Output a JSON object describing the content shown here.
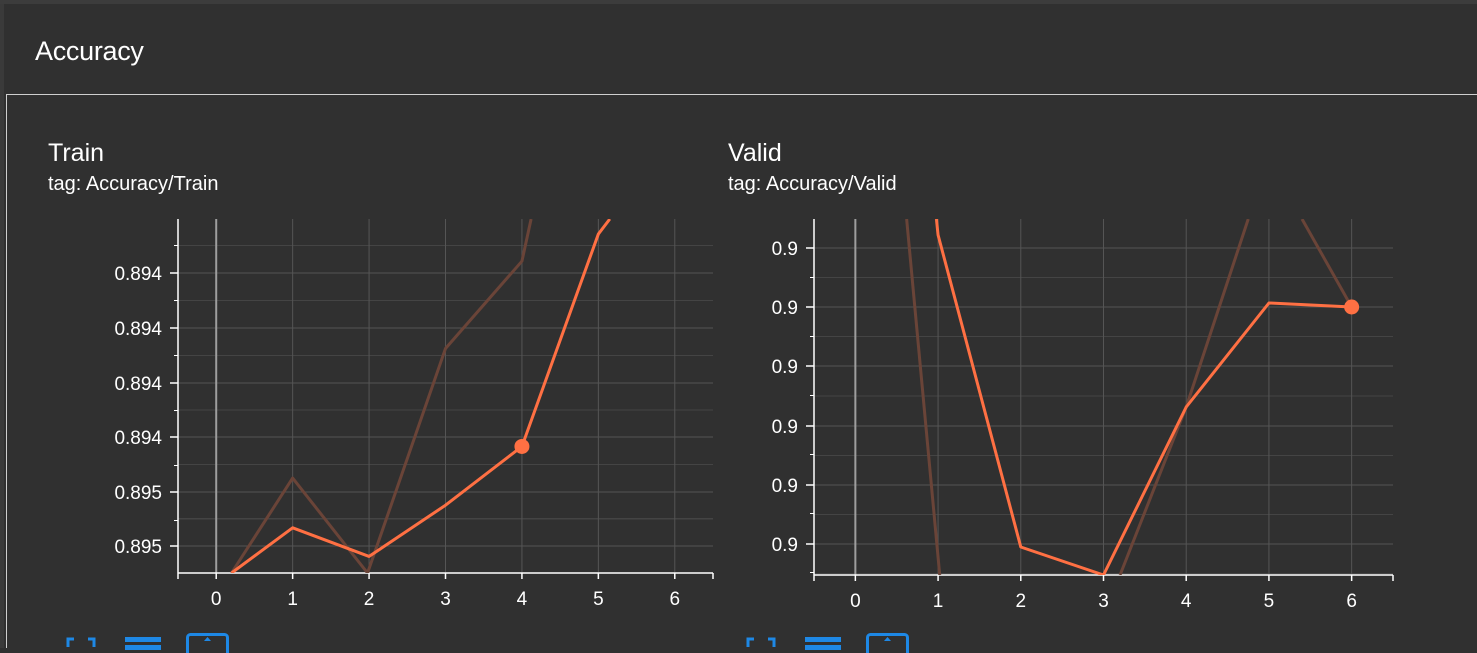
{
  "section": {
    "title": "Accuracy"
  },
  "colors": {
    "background": "#303030",
    "line": "#ff7043",
    "raw_line": "#6a4438",
    "grid": "#555555",
    "axis": "#ffffff",
    "zero_line": "#9e9e9e",
    "button_accent": "#1e88e5"
  },
  "cards": [
    {
      "title": "Train",
      "tag": "tag: Accuracy/Train",
      "controls": [
        "fullscreen-icon",
        "toggle-log-icon",
        "fit-domain-icon"
      ]
    },
    {
      "title": "Valid",
      "tag": "tag: Accuracy/Valid",
      "controls": [
        "fullscreen-icon",
        "toggle-log-icon",
        "fit-domain-icon"
      ]
    }
  ],
  "chart_data": [
    {
      "type": "line",
      "title": "Train",
      "xlabel": "",
      "ylabel": "",
      "x_ticks": [
        "0",
        "1",
        "2",
        "3",
        "4",
        "5",
        "6"
      ],
      "y_ticks": [
        "0.894",
        "0.894",
        "0.894",
        "0.894",
        "0.895",
        "0.895"
      ],
      "xlim": [
        -0.5,
        6.5
      ],
      "ylim": [
        0.89362,
        0.89597
      ],
      "grid": true,
      "series": [
        {
          "role": "smoothed",
          "x": [
            0.2,
            1,
            2,
            3,
            4,
            5,
            5.15
          ],
          "y": [
            0.89362,
            0.89392,
            0.89373,
            0.89407,
            0.89446,
            0.89587,
            0.89597
          ],
          "highlight_index": 4
        },
        {
          "role": "raw",
          "x": [
            0.2,
            1,
            1.98,
            3,
            4,
            4.12
          ],
          "y": [
            0.89362,
            0.89425,
            0.89362,
            0.89511,
            0.89569,
            0.89597
          ]
        }
      ]
    },
    {
      "type": "line",
      "title": "Valid",
      "xlabel": "",
      "ylabel": "",
      "x_ticks": [
        "0",
        "1",
        "2",
        "3",
        "4",
        "5",
        "6"
      ],
      "y_ticks": [
        "0.9",
        "0.9",
        "0.9",
        "0.9",
        "0.9",
        "0.9"
      ],
      "xlim": [
        -0.5,
        6.5
      ],
      "ylim": [
        0,
        356
      ],
      "grid": true,
      "series": [
        {
          "role": "smoothed",
          "x": [
            0.98,
            1,
            2,
            3,
            4,
            5,
            6
          ],
          "y": [
            356,
            340,
            28,
            0,
            168,
            272,
            268
          ],
          "highlight_index": 6
        },
        {
          "role": "raw",
          "x": [
            0.62,
            1.02
          ],
          "y": [
            356,
            0
          ]
        },
        {
          "role": "raw",
          "x": [
            3.2,
            4,
            4.75
          ],
          "y": [
            0,
            168,
            356
          ]
        },
        {
          "role": "raw",
          "x": [
            5.4,
            6
          ],
          "y": [
            356,
            268
          ]
        }
      ]
    }
  ]
}
